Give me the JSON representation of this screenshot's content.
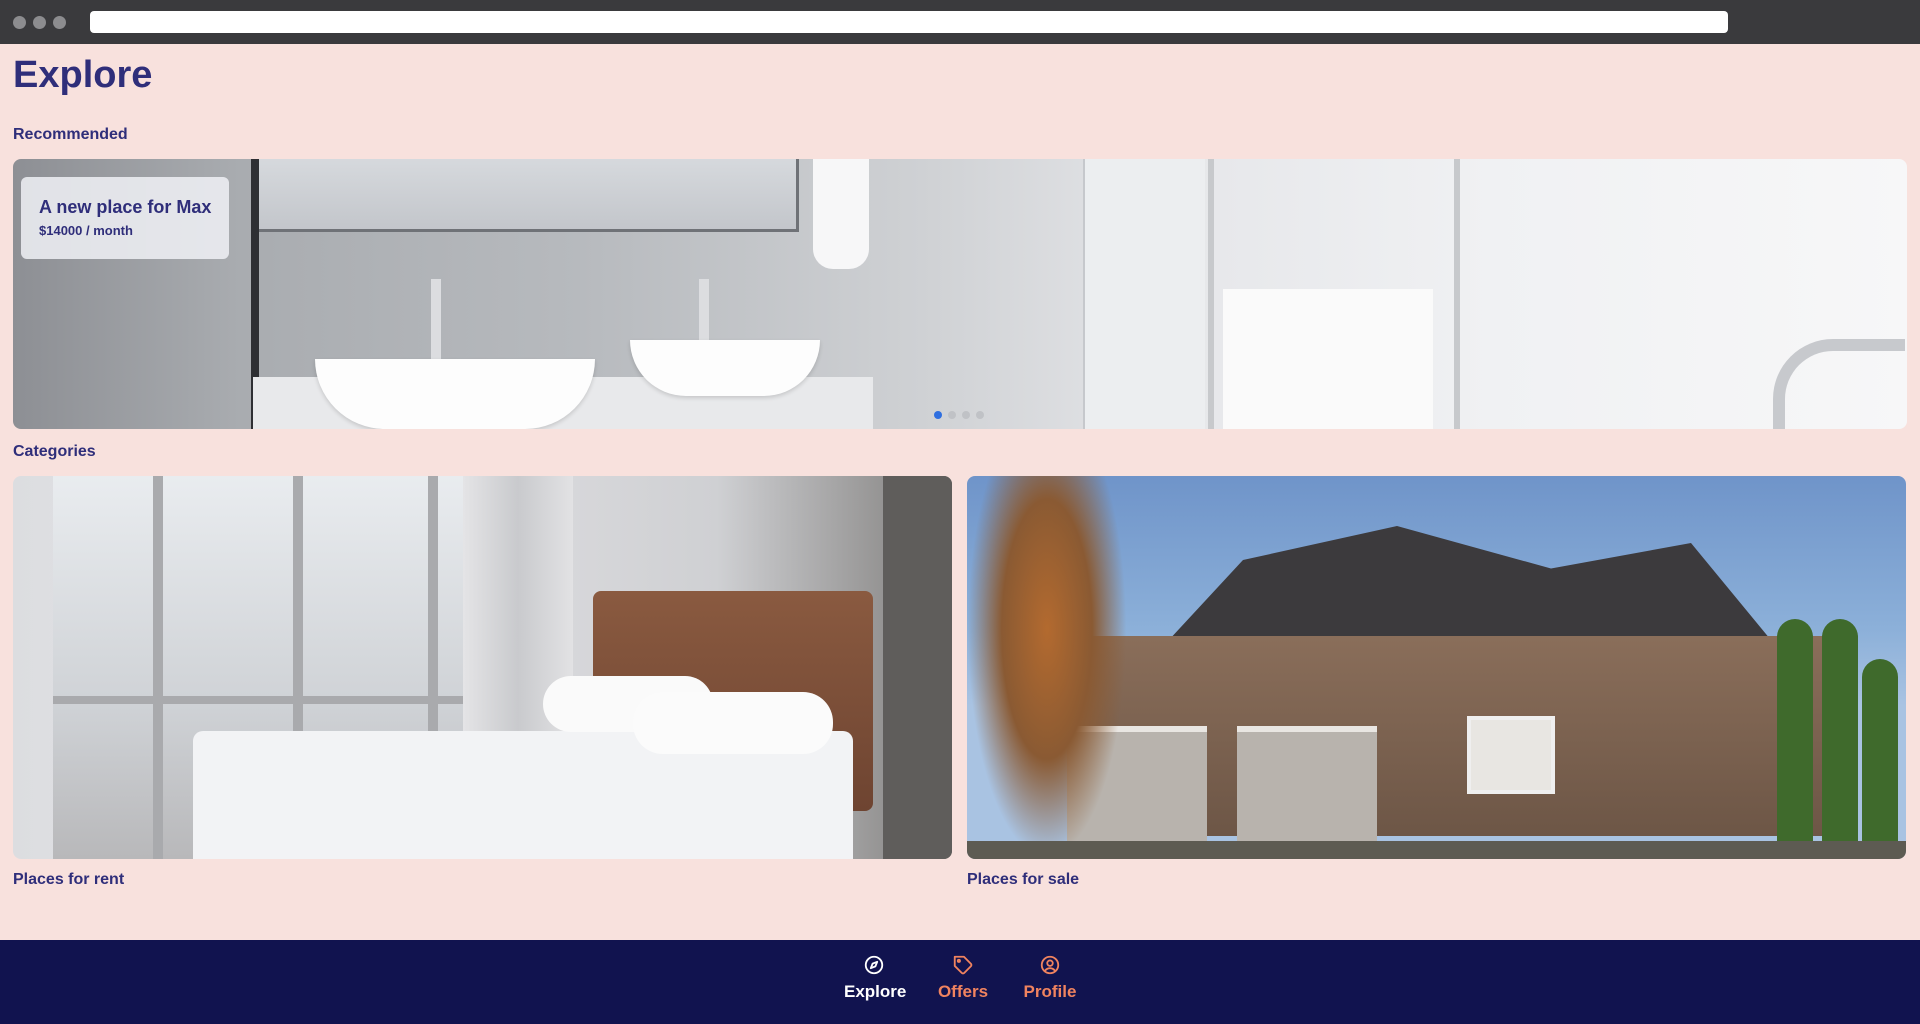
{
  "page": {
    "title": "Explore"
  },
  "sections": {
    "recommended_label": "Recommended",
    "categories_label": "Categories"
  },
  "recommended": {
    "title": "A new place for Max",
    "price": "$14000 / month",
    "carousel": {
      "count": 4,
      "active": 1
    }
  },
  "categories": [
    {
      "label": "Places for rent"
    },
    {
      "label": "Places for sale"
    }
  ],
  "nav": {
    "items": [
      {
        "label": "Explore",
        "icon": "compass-icon",
        "active": true
      },
      {
        "label": "Offers",
        "icon": "tag-icon",
        "active": false
      },
      {
        "label": "Profile",
        "icon": "user-circle-icon",
        "active": false
      }
    ]
  },
  "colors": {
    "background": "#f8e1dd",
    "text": "#2f2e7a",
    "nav_background": "#11134f",
    "nav_active": "#ffffff",
    "nav_inactive": "#f0835f",
    "carousel_active": "#2f6fe0"
  }
}
